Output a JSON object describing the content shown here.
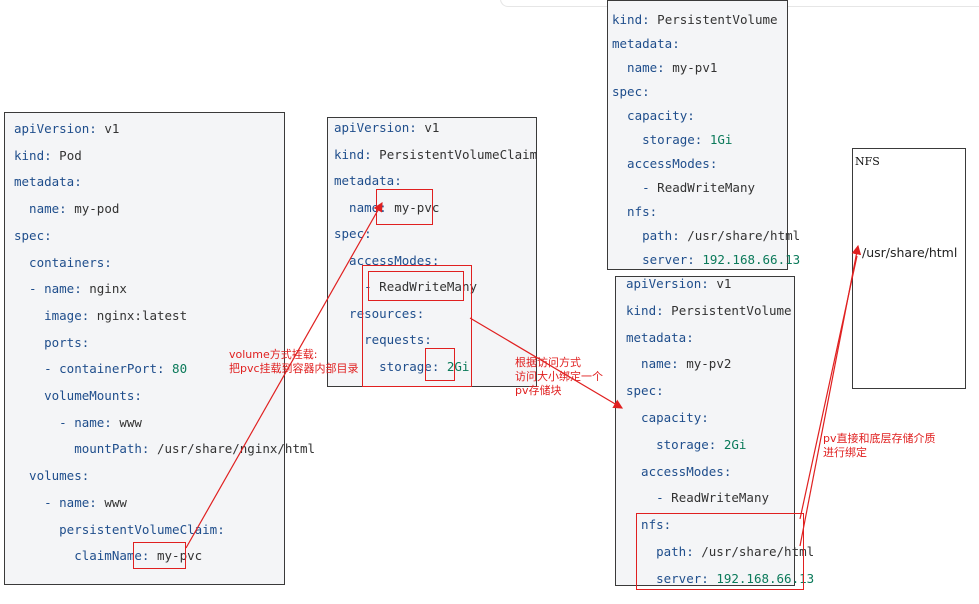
{
  "pod": {
    "lines": [
      {
        "k": "apiVersion:",
        "v": " v1"
      },
      {
        "k": "kind:",
        "v": " Pod"
      },
      {
        "k": "metadata:",
        "v": ""
      },
      {
        "k": "  name:",
        "v": " my-pod"
      },
      {
        "k": "spec:",
        "v": ""
      },
      {
        "k": "  containers:",
        "v": ""
      },
      {
        "k": "  - name:",
        "v": " nginx"
      },
      {
        "k": "    image:",
        "v": " nginx:latest"
      },
      {
        "k": "    ports:",
        "v": ""
      },
      {
        "k": "    - containerPort:",
        "v": " 80"
      },
      {
        "k": "    volumeMounts:",
        "v": ""
      },
      {
        "k": "      - name:",
        "v": " www"
      },
      {
        "k": "        mountPath:",
        "v": " /usr/share/nginx/html"
      },
      {
        "k": "  volumes:",
        "v": ""
      },
      {
        "k": "    - name:",
        "v": " www"
      },
      {
        "k": "      persistentVolumeClaim:",
        "v": ""
      },
      {
        "k": "        claimName:",
        "v": " my-pvc"
      }
    ]
  },
  "pvc": {
    "lines": [
      {
        "k": "apiVersion:",
        "v": " v1"
      },
      {
        "k": "kind:",
        "v": " PersistentVolumeClaim"
      },
      {
        "k": "metadata:",
        "v": ""
      },
      {
        "k": "  name:",
        "v": " my-pvc"
      },
      {
        "k": "spec:",
        "v": ""
      },
      {
        "k": "  accessModes:",
        "v": ""
      },
      {
        "k": "    -",
        "v": " ReadWriteMany"
      },
      {
        "k": "  resources:",
        "v": ""
      },
      {
        "k": "    requests:",
        "v": ""
      },
      {
        "k": "      storage:",
        "v": " 2Gi"
      }
    ]
  },
  "pv1": {
    "lines": [
      {
        "k": "kind:",
        "v": " PersistentVolume"
      },
      {
        "k": "metadata:",
        "v": ""
      },
      {
        "k": "  name:",
        "v": " my-pv1"
      },
      {
        "k": "spec:",
        "v": ""
      },
      {
        "k": "  capacity:",
        "v": ""
      },
      {
        "k": "    storage:",
        "v": " 1Gi"
      },
      {
        "k": "  accessModes:",
        "v": ""
      },
      {
        "k": "    -",
        "v": " ReadWriteMany"
      },
      {
        "k": "  nfs:",
        "v": ""
      },
      {
        "k": "    path:",
        "v": " /usr/share/html"
      },
      {
        "k": "    server:",
        "v": " 192.168.66.13"
      }
    ]
  },
  "pv2": {
    "lines": [
      {
        "k": "apiVersion:",
        "v": " v1"
      },
      {
        "k": "kind:",
        "v": " PersistentVolume"
      },
      {
        "k": "metadata:",
        "v": ""
      },
      {
        "k": "  name:",
        "v": " my-pv2"
      },
      {
        "k": "spec:",
        "v": ""
      },
      {
        "k": "  capacity:",
        "v": ""
      },
      {
        "k": "    storage:",
        "v": " 2Gi"
      },
      {
        "k": "  accessModes:",
        "v": ""
      },
      {
        "k": "    -",
        "v": " ReadWriteMany"
      },
      {
        "k": "  nfs:",
        "v": ""
      },
      {
        "k": "    path:",
        "v": " /usr/share/html"
      },
      {
        "k": "    server:",
        "v": " 192.168.66.13"
      }
    ]
  },
  "nfs": {
    "title": "NFS",
    "path": "/usr/share/html"
  },
  "notes": {
    "mount": "volume方式挂载:\n把pvc挂载到容器内部目录",
    "bind": "根据访问方式\n访问大小绑定一个\npv存储块",
    "storage": "pv直接和底层存储介质\n进行绑定"
  }
}
